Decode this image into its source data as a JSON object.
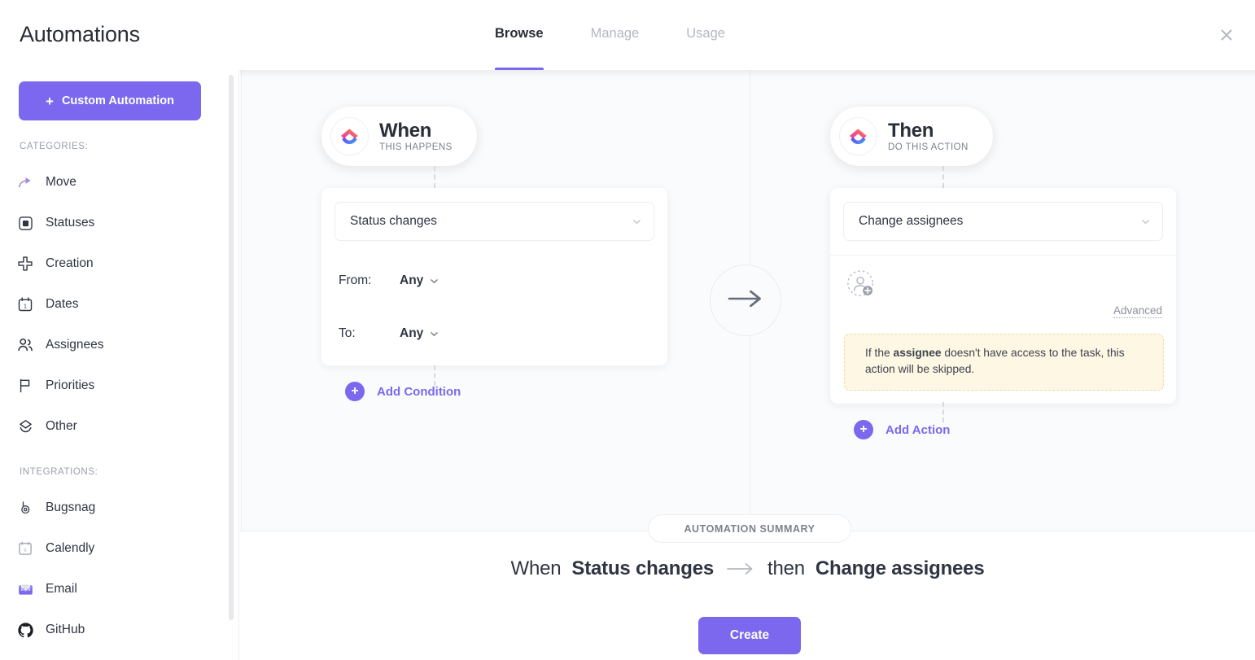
{
  "header": {
    "title": "Automations",
    "tabs": [
      {
        "label": "Browse",
        "active": true
      },
      {
        "label": "Manage",
        "active": false
      },
      {
        "label": "Usage",
        "active": false
      }
    ],
    "close_icon": "close-icon"
  },
  "sidebar": {
    "custom_automation_label": "Custom Automation",
    "categories_label": "CATEGORIES:",
    "integrations_label": "INTEGRATIONS:",
    "categories": [
      {
        "label": "Move",
        "icon": "share-arrow-icon"
      },
      {
        "label": "Statuses",
        "icon": "status-square-icon"
      },
      {
        "label": "Creation",
        "icon": "plus-cross-icon"
      },
      {
        "label": "Dates",
        "icon": "calendar-icon"
      },
      {
        "label": "Assignees",
        "icon": "people-icon"
      },
      {
        "label": "Priorities",
        "icon": "flag-icon"
      },
      {
        "label": "Other",
        "icon": "layers-icon"
      }
    ],
    "integrations": [
      {
        "label": "Bugsnag",
        "icon": "bugsnag-icon"
      },
      {
        "label": "Calendly",
        "icon": "calendly-icon"
      },
      {
        "label": "Email",
        "icon": "email-icon"
      },
      {
        "label": "GitHub",
        "icon": "github-icon"
      }
    ]
  },
  "flow": {
    "when": {
      "pill_title": "When",
      "pill_subtitle": "THIS HAPPENS",
      "logo_icon": "clickup-logo-icon",
      "trigger_value": "Status changes",
      "chevron_icon": "chevron-down-icon",
      "conditions": [
        {
          "label": "From:",
          "value": "Any"
        },
        {
          "label": "To:",
          "value": "Any"
        }
      ],
      "add_label": "Add Condition"
    },
    "connector_icon": "arrow-right-icon",
    "then": {
      "pill_title": "Then",
      "pill_subtitle": "DO THIS ACTION",
      "logo_icon": "clickup-logo-icon",
      "action_value": "Change assignees",
      "chevron_icon": "chevron-down-icon",
      "avatar_icon": "add-assignee-icon",
      "advanced_label": "Advanced",
      "warning": {
        "prefix": "If the ",
        "bold": "assignee",
        "suffix": " doesn't have access to the task, this action will be skipped."
      },
      "add_label": "Add Action"
    }
  },
  "summary": {
    "chip_label": "AUTOMATION SUMMARY",
    "when_word": "When",
    "trigger": "Status changes",
    "arrow_icon": "arrow-right-icon",
    "then_word": "then",
    "action": "Change assignees",
    "create_label": "Create"
  },
  "colors": {
    "accent": "#7b68ee",
    "canvas_bg": "#fafbfc",
    "warning_bg": "#fdf7e3",
    "text": "#2f3542",
    "muted": "#b5b8c0"
  }
}
